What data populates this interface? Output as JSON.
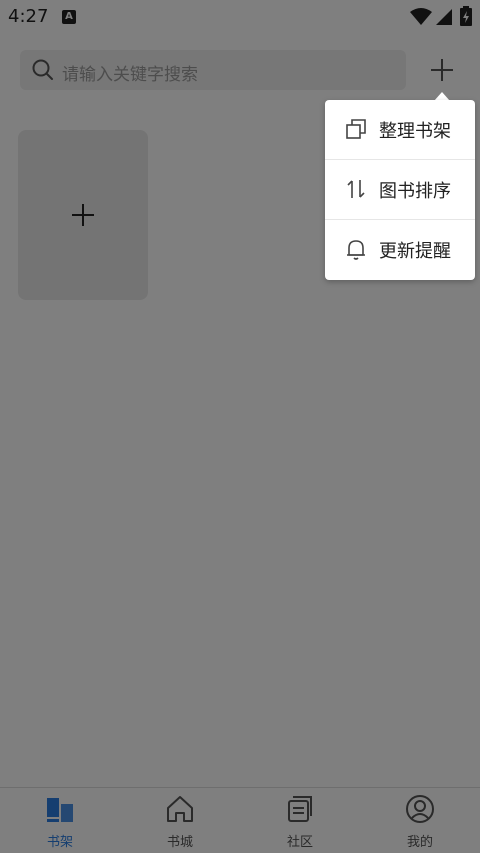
{
  "status_bar": {
    "time": "4:27",
    "notification_badge": "A"
  },
  "search": {
    "placeholder": "请输入关键字搜索"
  },
  "menu": {
    "items": [
      {
        "label": "整理书架",
        "icon": "copy-icon"
      },
      {
        "label": "图书排序",
        "icon": "sort-icon"
      },
      {
        "label": "更新提醒",
        "icon": "bell-icon"
      }
    ]
  },
  "bottom_nav": {
    "items": [
      {
        "label": "书架",
        "icon": "bookshelf-icon",
        "active": true
      },
      {
        "label": "书城",
        "icon": "home-icon",
        "active": false
      },
      {
        "label": "社区",
        "icon": "community-icon",
        "active": false
      },
      {
        "label": "我的",
        "icon": "profile-icon",
        "active": false
      }
    ]
  },
  "colors": {
    "accent": "#2a7de1",
    "overlay": "#000000"
  }
}
